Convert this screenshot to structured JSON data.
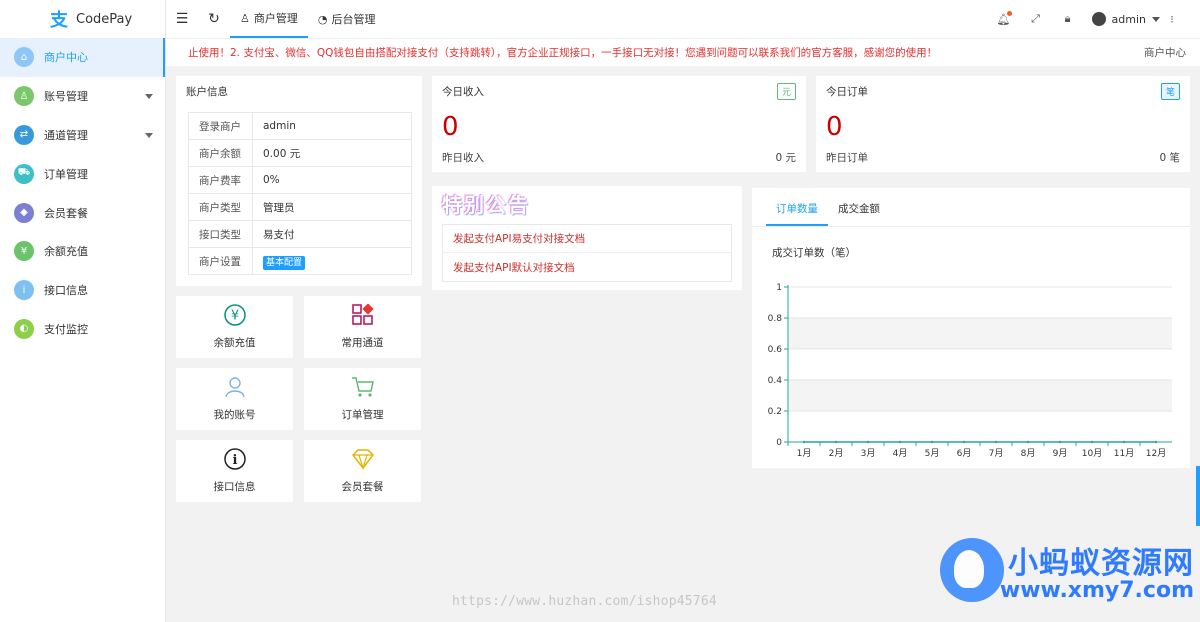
{
  "app": {
    "logo_glyph": "支",
    "name": "CodePay"
  },
  "colors": {
    "accent": "#1e9fff",
    "danger": "#e62e2e",
    "zero": "#cc0000"
  },
  "sidebar": {
    "items": [
      {
        "label": "商户中心",
        "icon": "home-icon",
        "color": "#8ec6f5",
        "active": true
      },
      {
        "label": "账号管理",
        "icon": "user-icon",
        "color": "#7bc86c",
        "caret": true
      },
      {
        "label": "通道管理",
        "icon": "channel-icon",
        "color": "#3a9ad9",
        "caret": true
      },
      {
        "label": "订单管理",
        "icon": "cart-icon",
        "color": "#3cc0c6"
      },
      {
        "label": "会员套餐",
        "icon": "diamond-icon",
        "color": "#7d7fd3"
      },
      {
        "label": "余额充值",
        "icon": "yen-icon",
        "color": "#6cc36c"
      },
      {
        "label": "接口信息",
        "icon": "info-icon",
        "color": "#7ec0f0"
      },
      {
        "label": "支付监控",
        "icon": "monitor-icon",
        "color": "#8ccf4a"
      }
    ]
  },
  "header": {
    "tabs": [
      {
        "label": "商户管理",
        "icon": "user-icon",
        "active": true
      },
      {
        "label": "后台管理",
        "icon": "dashboard-icon",
        "active": false
      }
    ],
    "user": "admin"
  },
  "notice": {
    "text": "止使用！2. 支付宝、微信、QQ钱包自由搭配对接支付（支持跳转），官方企业正规接口，一手接口无对接！您遇到问题可以联系我们的官方客服，感谢您的使用！",
    "breadcrumb": "商户中心"
  },
  "account": {
    "title": "账户信息",
    "rows": [
      {
        "key": "登录商户",
        "value": "admin"
      },
      {
        "key": "商户余额",
        "value": "0.00 元"
      },
      {
        "key": "商户费率",
        "value": "0%"
      },
      {
        "key": "商户类型",
        "value": "管理员"
      },
      {
        "key": "接口类型",
        "value": "易支付"
      },
      {
        "key": "商户设置",
        "value": "基本配置"
      }
    ]
  },
  "tiles": [
    {
      "label": "余额充值",
      "icon": "yen-icon"
    },
    {
      "label": "常用通道",
      "icon": "apps-icon"
    },
    {
      "label": "我的账号",
      "icon": "user-icon"
    },
    {
      "label": "订单管理",
      "icon": "cart-icon"
    },
    {
      "label": "接口信息",
      "icon": "info-icon"
    },
    {
      "label": "会员套餐",
      "icon": "diamond-icon"
    }
  ],
  "income": {
    "title": "今日收入",
    "badge": "元",
    "value": "0",
    "sub_label": "昨日收入",
    "sub_value": "0 元"
  },
  "orders": {
    "title": "今日订单",
    "badge": "笔",
    "value": "0",
    "sub_label": "昨日订单",
    "sub_value": "0 笔"
  },
  "announcement": {
    "title": "特别公告",
    "links": [
      "发起支付API易支付对接文档",
      "发起支付API默认对接文档"
    ]
  },
  "chart_tabs": [
    "订单数量",
    "成交金额"
  ],
  "chart_data": {
    "type": "line",
    "title": "成交订单数（笔）",
    "categories": [
      "1月",
      "2月",
      "3月",
      "4月",
      "5月",
      "6月",
      "7月",
      "8月",
      "9月",
      "10月",
      "11月",
      "12月"
    ],
    "values": [
      0,
      0,
      0,
      0,
      0,
      0,
      0,
      0,
      0,
      0,
      0,
      0
    ],
    "yticks": [
      "0",
      "0.2",
      "0.4",
      "0.6",
      "0.8",
      "1"
    ],
    "ylim": [
      0,
      1
    ],
    "color": "#26a69a"
  },
  "watermark": {
    "url": "https://www.huzhan.com/ishop45764",
    "brand_cn": "小蚂蚁资源网",
    "brand_en": "www.xmy7.com"
  }
}
